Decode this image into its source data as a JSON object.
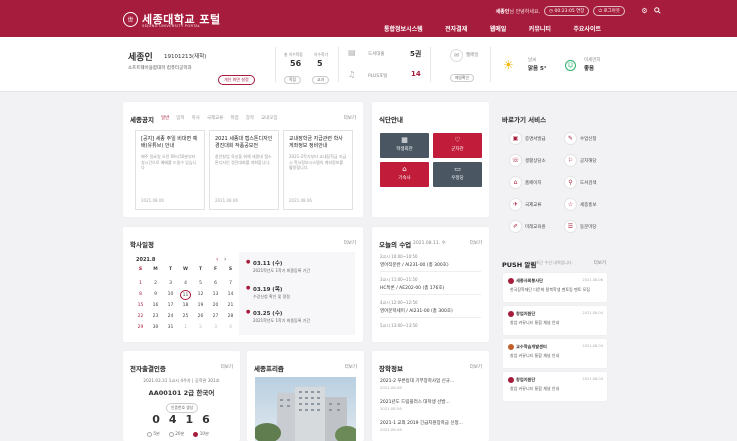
{
  "header": {
    "logo_mark": "世",
    "title": "세종대학교 포털",
    "subtitle": "SEJONG UNIVERSITY PORTAL",
    "user_name": "세종인",
    "greeting": "님 안녕하세요.",
    "session_time": "00:23:05 연장",
    "logout": "로그아웃",
    "nav": [
      "통합정보시스템",
      "전자결재",
      "웹메일",
      "커뮤니티",
      "주요사이트"
    ]
  },
  "profile": {
    "name": "세종인",
    "id": "19101213(재학)",
    "dept": "소프트웨어융합대학 컴퓨터공학과",
    "edit_btn": "개인 화면 설정",
    "stats": [
      {
        "label": "총 이수학점",
        "value": "56"
      },
      {
        "label": "이수학기",
        "value": "5"
      }
    ],
    "links": [
      "학점",
      "교과"
    ],
    "library_label": "도서대출",
    "library_value": "5권",
    "plus_label": "PLUS포털",
    "plus_value": "14",
    "webmail_label": "웹메일",
    "webmail_btn": "메일확인",
    "weather_label": "날씨",
    "weather_value": "맑음 5°",
    "dust_label": "미세먼지",
    "dust_value": "좋음"
  },
  "notices": {
    "title": "세종공지",
    "tabs": [
      "일반",
      "입학",
      "학사",
      "국제교류",
      "취업",
      "장학",
      "교내모집"
    ],
    "more": "더보기",
    "items": [
      {
        "title": "[공지] 세종 주일 비대면 예배(유튜브) 안내",
        "body": "매주 일요일 오전 09시50분부터 실시간으로 예배를 드릴수 있습니다",
        "date": "2021.08.06"
      },
      {
        "title": "2021 세종대 캡스톤디자인 경진대회 작품공모전",
        "body": "창년창업 육성을 위해 세종대 캡스톤디자인 경진대회를 개최합니다.",
        "date": "2021.08.06"
      },
      {
        "title": "교내장학금 지급관련 학사게좌정보 정비안내",
        "body": "2021-2학기부터 교내장학금 지급시 학사정보시스템의 계좌정보를 활용합니다.",
        "date": "2021.08.06"
      }
    ]
  },
  "cafeteria": {
    "title": "식단안내",
    "items": [
      {
        "label": "학생회관",
        "icon": "dining-icon"
      },
      {
        "label": "군자관",
        "icon": "heart-icon"
      },
      {
        "label": "기숙사",
        "icon": "dorm-icon"
      },
      {
        "label": "우정당",
        "icon": "tray-icon"
      }
    ]
  },
  "shortcuts": {
    "title": "바로가기 서비스",
    "items": [
      "증명서발급",
      "수업신청",
      "생활상담소",
      "공지해당",
      "홈페이지",
      "도서검색",
      "국제교류",
      "세종홍보",
      "미래교육원",
      "동문마당"
    ]
  },
  "calendar": {
    "title": "학사일정",
    "month": "2021.8",
    "more": "더보기",
    "weekdays": [
      "S",
      "M",
      "T",
      "W",
      "T",
      "F",
      "S"
    ],
    "weeks": [
      [
        "1",
        "2",
        "3",
        "4",
        "5",
        "6",
        "7"
      ],
      [
        "8",
        "9",
        "10",
        "11",
        "12",
        "13",
        "14"
      ],
      [
        "15",
        "16",
        "17",
        "18",
        "19",
        "20",
        "21"
      ],
      [
        "22",
        "23",
        "24",
        "25",
        "26",
        "27",
        "28"
      ],
      [
        "29",
        "30",
        "31",
        "1",
        "2",
        "3",
        "4"
      ]
    ],
    "today": "11",
    "events": [
      {
        "date": "03.11 (수)",
        "desc": "2021학년도 1학기 최종등록 기간"
      },
      {
        "date": "03.19 (목)",
        "desc": "수강신청 확인 및 정정"
      },
      {
        "date": "03.25 (수)",
        "desc": "2021학년도 1학기 최종등록 기간"
      }
    ]
  },
  "classes": {
    "title": "오늘의 수업",
    "date": "2021.08.11. 수",
    "more": "더보기",
    "items": [
      {
        "time": "2교시  10:00~10:50",
        "name": "영어작문반 / AI231-00 (총 300호)"
      },
      {
        "time": "3교시  11:00~11:50",
        "name": "HC특론 / AE202-00 (총 176호)"
      },
      {
        "time": "4교시  12:00~12:50",
        "name": "영어문학세미 / AI231-00 (총 300호)"
      },
      {
        "time": "5교시  13:00~13:50",
        "name": ""
      }
    ]
  },
  "push": {
    "title": "PUSH 알림",
    "subtitle": "최근 수신 내역입니다.",
    "more": "더보기",
    "items": [
      {
        "sender": "세종사회봉사단",
        "date": "2021.08.06",
        "text": "한국장학재단 다문화 탈북학생 멘토링 멘토 모집"
      },
      {
        "sender": "창업지원단",
        "date": "2021.08.04",
        "text": "창업 커뮤니티 통합 채널 안내"
      },
      {
        "sender": "교수학습개발센터",
        "date": "2021.08.04",
        "text": "창업 커뮤니티 통합 채널 안내"
      },
      {
        "sender": "창업지원단",
        "date": "2021.08.04",
        "text": "창업 커뮤니티 통합 채널 안내"
      }
    ]
  },
  "attendance": {
    "title": "전자출결인증",
    "more": "더보기",
    "info": "2021.03.31 1교시 4주차 | 공학관 301호",
    "course": "AA00101 2급 한국어",
    "btn": "인증번호 생성",
    "code": [
      "0",
      "4",
      "1",
      "6"
    ],
    "options": [
      "5분",
      "20분",
      "10분"
    ],
    "selected": 2
  },
  "press": {
    "title": "세종프리즘",
    "more": "더보기"
  },
  "scholarship": {
    "title": "장학정보",
    "more": "더보기",
    "items": [
      {
        "title": "2021-2 푸른등대 기부장학사업 신규...",
        "date": "2021.08.06"
      },
      {
        "title": "2021년도 드림플러스 대학생 선발...",
        "date": "2021.08.06"
      },
      {
        "title": "2021-1 교외 2019 긴급지원장학금 신청...",
        "date": "2021.08.06"
      }
    ]
  }
}
